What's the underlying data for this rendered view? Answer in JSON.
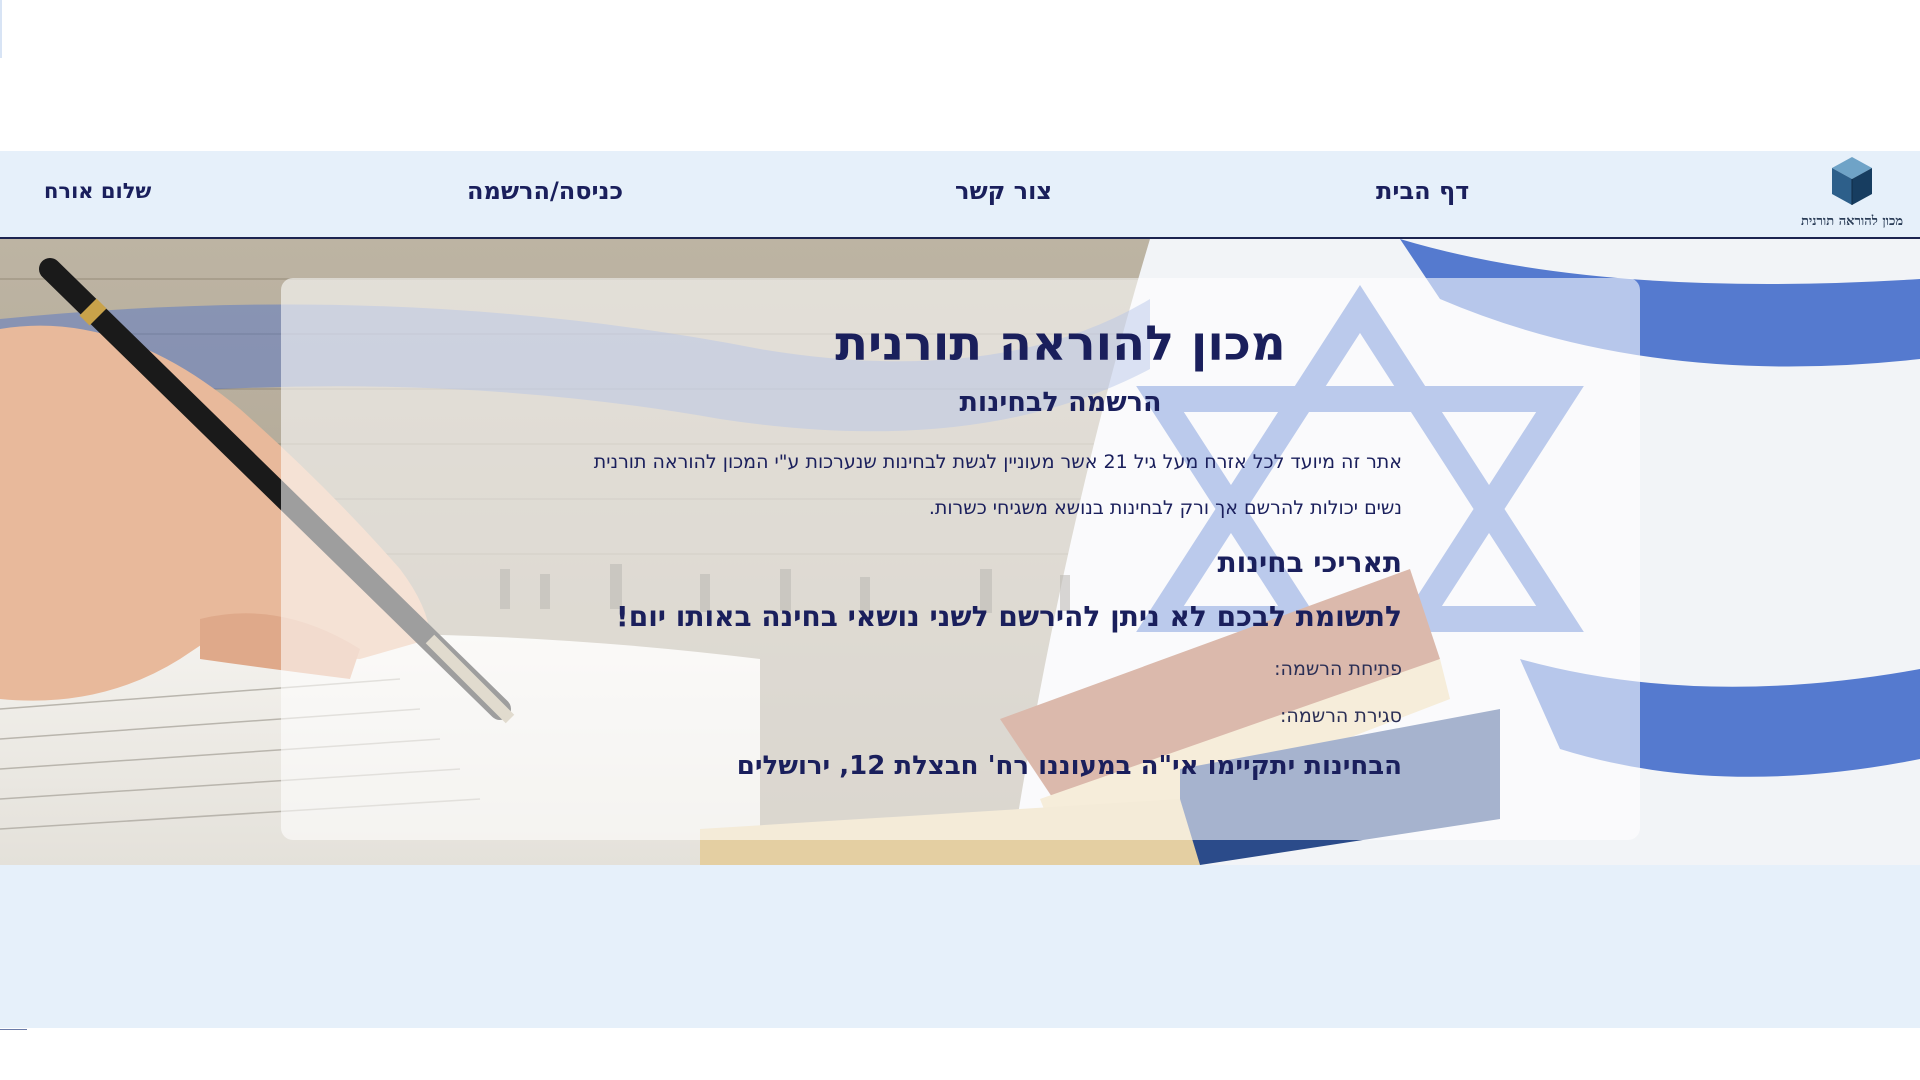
{
  "nav": {
    "home": "דף הבית",
    "contact": "צור קשר",
    "login_register": "כניסה/הרשמה",
    "greeting": "שלום אורח"
  },
  "logo": {
    "text": "מכון להוראה תורנית",
    "icon": "cube-icon"
  },
  "hero": {
    "title": "מכון להוראה תורנית",
    "subtitle": "הרשמה לבחינות",
    "paragraph_1": "אתר זה מיועד לכל אזרח מעל גיל 21 אשר מעוניין לגשת לבחינות שנערכות ע\"י המכון להוראה תורנית",
    "paragraph_2": "נשים יכולות להרשם אך ורק לבחינות בנושא משגיחי כשרות.",
    "dates_heading": "תאריכי בחינות",
    "note": "לתשומת לבכם לא ניתן להירשם לשני נושאי בחינה באותו יום!",
    "registration_open_label": "פתיחת הרשמה:",
    "registration_close_label": "סגירת הרשמה:",
    "location": "הבחינות יתקיימו אי\"ה במעוננו רח' חבצלת 12, ירושלים"
  },
  "colors": {
    "nav_bg": "#e6f0fa",
    "text_navy": "#1a1f5c",
    "flag_blue": "#3a64c8"
  }
}
